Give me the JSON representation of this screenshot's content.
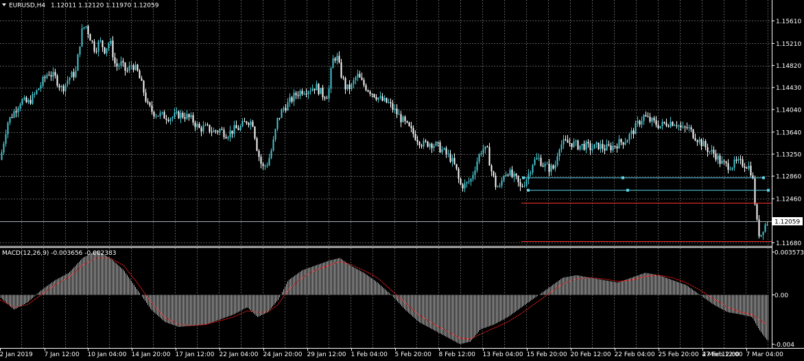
{
  "chart_header": {
    "symbol": "EURUSD,H4",
    "ohlc": "1.12011 1.12120 1.11970 1.12059"
  },
  "macd_header": {
    "label": "MACD(12,26,9) -0.003656 -0.002383"
  },
  "colors": {
    "background": "#000000",
    "grid": "#5a5a5a",
    "bull_candle": "#46c8d2",
    "bear_candle": "#ffffff",
    "macd_histogram": "#c0c0c0",
    "macd_signal": "#ff2020",
    "support_lines": "#ff3030",
    "trend_lines": "#5fd6e6",
    "current_price_line": "#a8b0bc"
  },
  "current_price_tag": "1.12059",
  "chart_data": [
    {
      "type": "candlestick",
      "title": "EURUSD,H4",
      "price_axis_ticks": [
        "1.15610",
        "1.15210",
        "1.14820",
        "1.14430",
        "1.14040",
        "1.13640",
        "1.13250",
        "1.12860",
        "1.12460",
        "1.11680"
      ],
      "ylim": [
        1.1166,
        1.1581
      ],
      "time_axis_labels": [
        "2 Jan 2019",
        "7 Jan 12:00",
        "10 Jan 04:00",
        "14 Jan 20:00",
        "17 Jan 12:00",
        "22 Jan 04:00",
        "24 Jan 20:00",
        "29 Jan 12:00",
        "1 Feb 04:00",
        "5 Feb 20:00",
        "8 Feb 12:00",
        "13 Feb 04:00",
        "15 Feb 20:00",
        "20 Feb 12:00",
        "22 Feb 04:00",
        "25 Feb 20:00",
        "27 Feb 12:00",
        "4 Mar 12:00",
        "7 Mar 04:00"
      ],
      "close_path": [
        [
          0,
          1.1315
        ],
        [
          10,
          1.138
        ],
        [
          20,
          1.14
        ],
        [
          30,
          1.142
        ],
        [
          40,
          1.1415
        ],
        [
          50,
          1.143
        ],
        [
          60,
          1.145
        ],
        [
          70,
          1.147
        ],
        [
          80,
          1.146
        ],
        [
          90,
          1.144
        ],
        [
          100,
          1.146
        ],
        [
          110,
          1.147
        ],
        [
          118,
          1.154
        ],
        [
          124,
          1.1555
        ],
        [
          130,
          1.1535
        ],
        [
          138,
          1.151
        ],
        [
          145,
          1.1525
        ],
        [
          152,
          1.151
        ],
        [
          160,
          1.1525
        ],
        [
          168,
          1.148
        ],
        [
          176,
          1.1485
        ],
        [
          184,
          1.147
        ],
        [
          192,
          1.1485
        ],
        [
          200,
          1.147
        ],
        [
          208,
          1.144
        ],
        [
          215,
          1.141
        ],
        [
          222,
          1.14
        ],
        [
          230,
          1.1395
        ],
        [
          240,
          1.1392
        ],
        [
          250,
          1.139
        ],
        [
          260,
          1.1395
        ],
        [
          270,
          1.1393
        ],
        [
          280,
          1.1385
        ],
        [
          290,
          1.137
        ],
        [
          300,
          1.1372
        ],
        [
          310,
          1.1365
        ],
        [
          320,
          1.1368
        ],
        [
          330,
          1.136
        ],
        [
          340,
          1.1368
        ],
        [
          350,
          1.1372
        ],
        [
          360,
          1.1385
        ],
        [
          368,
          1.138
        ],
        [
          375,
          1.133
        ],
        [
          382,
          1.13
        ],
        [
          390,
          1.131
        ],
        [
          397,
          1.134
        ],
        [
          404,
          1.1385
        ],
        [
          412,
          1.1405
        ],
        [
          420,
          1.1415
        ],
        [
          430,
          1.143
        ],
        [
          440,
          1.1438
        ],
        [
          450,
          1.144
        ],
        [
          460,
          1.1445
        ],
        [
          470,
          1.143
        ],
        [
          478,
          1.143
        ],
        [
          484,
          1.149
        ],
        [
          490,
          1.15
        ],
        [
          496,
          1.147
        ],
        [
          504,
          1.144
        ],
        [
          512,
          1.1445
        ],
        [
          520,
          1.1465
        ],
        [
          528,
          1.145
        ],
        [
          536,
          1.144
        ],
        [
          546,
          1.143
        ],
        [
          556,
          1.142
        ],
        [
          566,
          1.1415
        ],
        [
          576,
          1.14
        ],
        [
          586,
          1.1385
        ],
        [
          596,
          1.137
        ],
        [
          606,
          1.1355
        ],
        [
          616,
          1.1342
        ],
        [
          626,
          1.1345
        ],
        [
          636,
          1.134
        ],
        [
          646,
          1.133
        ],
        [
          656,
          1.1318
        ],
        [
          664,
          1.13
        ],
        [
          670,
          1.127
        ],
        [
          678,
          1.127
        ],
        [
          686,
          1.128
        ],
        [
          694,
          1.131
        ],
        [
          702,
          1.1335
        ],
        [
          710,
          1.133
        ],
        [
          716,
          1.1295
        ],
        [
          722,
          1.127
        ],
        [
          728,
          1.1265
        ],
        [
          734,
          1.129
        ],
        [
          740,
          1.1295
        ],
        [
          746,
          1.1285
        ],
        [
          752,
          1.128
        ],
        [
          758,
          1.1265
        ],
        [
          764,
          1.1275
        ],
        [
          770,
          1.129
        ],
        [
          776,
          1.131
        ],
        [
          784,
          1.1318
        ],
        [
          792,
          1.1305
        ],
        [
          800,
          1.13
        ],
        [
          808,
          1.13
        ],
        [
          814,
          1.134
        ],
        [
          822,
          1.1345
        ],
        [
          832,
          1.1345
        ],
        [
          842,
          1.134
        ],
        [
          852,
          1.134
        ],
        [
          862,
          1.1335
        ],
        [
          872,
          1.134
        ],
        [
          882,
          1.1335
        ],
        [
          892,
          1.1338
        ],
        [
          902,
          1.1345
        ],
        [
          912,
          1.135
        ],
        [
          922,
          1.1365
        ],
        [
          930,
          1.138
        ],
        [
          938,
          1.1392
        ],
        [
          946,
          1.1385
        ],
        [
          954,
          1.138
        ],
        [
          962,
          1.1375
        ],
        [
          970,
          1.138
        ],
        [
          978,
          1.1382
        ],
        [
          986,
          1.138
        ],
        [
          994,
          1.1368
        ],
        [
          1002,
          1.1372
        ],
        [
          1010,
          1.136
        ],
        [
          1018,
          1.135
        ],
        [
          1026,
          1.134
        ],
        [
          1034,
          1.133
        ],
        [
          1042,
          1.1325
        ],
        [
          1050,
          1.131
        ],
        [
          1058,
          1.1305
        ],
        [
          1066,
          1.1305
        ],
        [
          1074,
          1.131
        ],
        [
          1082,
          1.1308
        ],
        [
          1090,
          1.1305
        ],
        [
          1096,
          1.129
        ],
        [
          1100,
          1.124
        ],
        [
          1104,
          1.119
        ],
        [
          1108,
          1.118
        ],
        [
          1112,
          1.1195
        ],
        [
          1118,
          1.1205
        ]
      ],
      "support_levels": [
        1.1239,
        1.1171
      ],
      "trend_lines": [
        {
          "from": [
            763,
            1.1283
          ],
          "to": [
            1113,
            1.1283
          ]
        },
        {
          "from": [
            770,
            1.1261
          ],
          "to": [
            1120,
            1.1261
          ]
        }
      ],
      "current_price": 1.12059
    },
    {
      "type": "histogram+line",
      "title": "MACD(12,26,9)",
      "main_value": -0.003656,
      "signal_value": -0.002383,
      "y_axis_ticks": [
        "0.003573",
        "0.00",
        "-0.004"
      ],
      "ylim": [
        -0.0042,
        0.0037
      ],
      "macd_path": [
        [
          0,
          -0.0002
        ],
        [
          20,
          -0.0012
        ],
        [
          40,
          -0.0006
        ],
        [
          60,
          0.0004
        ],
        [
          80,
          0.0012
        ],
        [
          100,
          0.0018
        ],
        [
          120,
          0.003
        ],
        [
          140,
          0.0036
        ],
        [
          160,
          0.003
        ],
        [
          180,
          0.002
        ],
        [
          200,
          0.0004
        ],
        [
          220,
          -0.0012
        ],
        [
          240,
          -0.0022
        ],
        [
          260,
          -0.0026
        ],
        [
          280,
          -0.0025
        ],
        [
          300,
          -0.0024
        ],
        [
          320,
          -0.002
        ],
        [
          340,
          -0.0016
        ],
        [
          360,
          -0.001
        ],
        [
          375,
          -0.0018
        ],
        [
          390,
          -0.0014
        ],
        [
          405,
          -0.0004
        ],
        [
          420,
          0.0012
        ],
        [
          440,
          0.002
        ],
        [
          460,
          0.0024
        ],
        [
          480,
          0.0028
        ],
        [
          495,
          0.003
        ],
        [
          510,
          0.0024
        ],
        [
          530,
          0.0018
        ],
        [
          550,
          0.001
        ],
        [
          570,
          0.0
        ],
        [
          590,
          -0.0012
        ],
        [
          610,
          -0.0022
        ],
        [
          630,
          -0.0028
        ],
        [
          650,
          -0.0034
        ],
        [
          670,
          -0.004
        ],
        [
          685,
          -0.0038
        ],
        [
          700,
          -0.0028
        ],
        [
          720,
          -0.0024
        ],
        [
          740,
          -0.0018
        ],
        [
          760,
          -0.001
        ],
        [
          780,
          -0.0002
        ],
        [
          800,
          0.0006
        ],
        [
          820,
          0.0014
        ],
        [
          840,
          0.0016
        ],
        [
          860,
          0.0014
        ],
        [
          880,
          0.0012
        ],
        [
          900,
          0.001
        ],
        [
          920,
          0.0014
        ],
        [
          940,
          0.0018
        ],
        [
          960,
          0.0016
        ],
        [
          980,
          0.0012
        ],
        [
          1000,
          0.0008
        ],
        [
          1020,
          0.0
        ],
        [
          1040,
          -0.0008
        ],
        [
          1060,
          -0.0014
        ],
        [
          1080,
          -0.0016
        ],
        [
          1096,
          -0.0018
        ],
        [
          1106,
          -0.0028
        ],
        [
          1118,
          -0.0037
        ]
      ],
      "signal_path": [
        [
          0,
          -0.0004
        ],
        [
          20,
          -0.001
        ],
        [
          40,
          -0.0008
        ],
        [
          60,
          0.0
        ],
        [
          80,
          0.0008
        ],
        [
          100,
          0.0014
        ],
        [
          120,
          0.0024
        ],
        [
          140,
          0.003
        ],
        [
          160,
          0.003
        ],
        [
          180,
          0.0024
        ],
        [
          200,
          0.001
        ],
        [
          220,
          -0.0006
        ],
        [
          240,
          -0.0018
        ],
        [
          260,
          -0.0024
        ],
        [
          280,
          -0.0025
        ],
        [
          300,
          -0.0024
        ],
        [
          320,
          -0.0021
        ],
        [
          340,
          -0.0018
        ],
        [
          360,
          -0.0013
        ],
        [
          375,
          -0.0014
        ],
        [
          390,
          -0.0014
        ],
        [
          405,
          -0.0008
        ],
        [
          420,
          0.0004
        ],
        [
          440,
          0.0014
        ],
        [
          460,
          0.002
        ],
        [
          480,
          0.0024
        ],
        [
          495,
          0.0027
        ],
        [
          510,
          0.0025
        ],
        [
          530,
          0.002
        ],
        [
          550,
          0.0014
        ],
        [
          570,
          0.0004
        ],
        [
          590,
          -0.0006
        ],
        [
          610,
          -0.0016
        ],
        [
          630,
          -0.0023
        ],
        [
          650,
          -0.0029
        ],
        [
          670,
          -0.0035
        ],
        [
          685,
          -0.0036
        ],
        [
          700,
          -0.0032
        ],
        [
          720,
          -0.0027
        ],
        [
          740,
          -0.0022
        ],
        [
          760,
          -0.0015
        ],
        [
          780,
          -0.0007
        ],
        [
          800,
          0.0001
        ],
        [
          820,
          0.0009
        ],
        [
          840,
          0.0013
        ],
        [
          860,
          0.0014
        ],
        [
          880,
          0.0013
        ],
        [
          900,
          0.0011
        ],
        [
          920,
          0.0012
        ],
        [
          940,
          0.0015
        ],
        [
          960,
          0.0016
        ],
        [
          980,
          0.0014
        ],
        [
          1000,
          0.001
        ],
        [
          1020,
          0.0004
        ],
        [
          1040,
          -0.0003
        ],
        [
          1060,
          -0.001
        ],
        [
          1080,
          -0.0014
        ],
        [
          1096,
          -0.0016
        ],
        [
          1106,
          -0.002
        ],
        [
          1118,
          -0.0024
        ]
      ]
    }
  ]
}
